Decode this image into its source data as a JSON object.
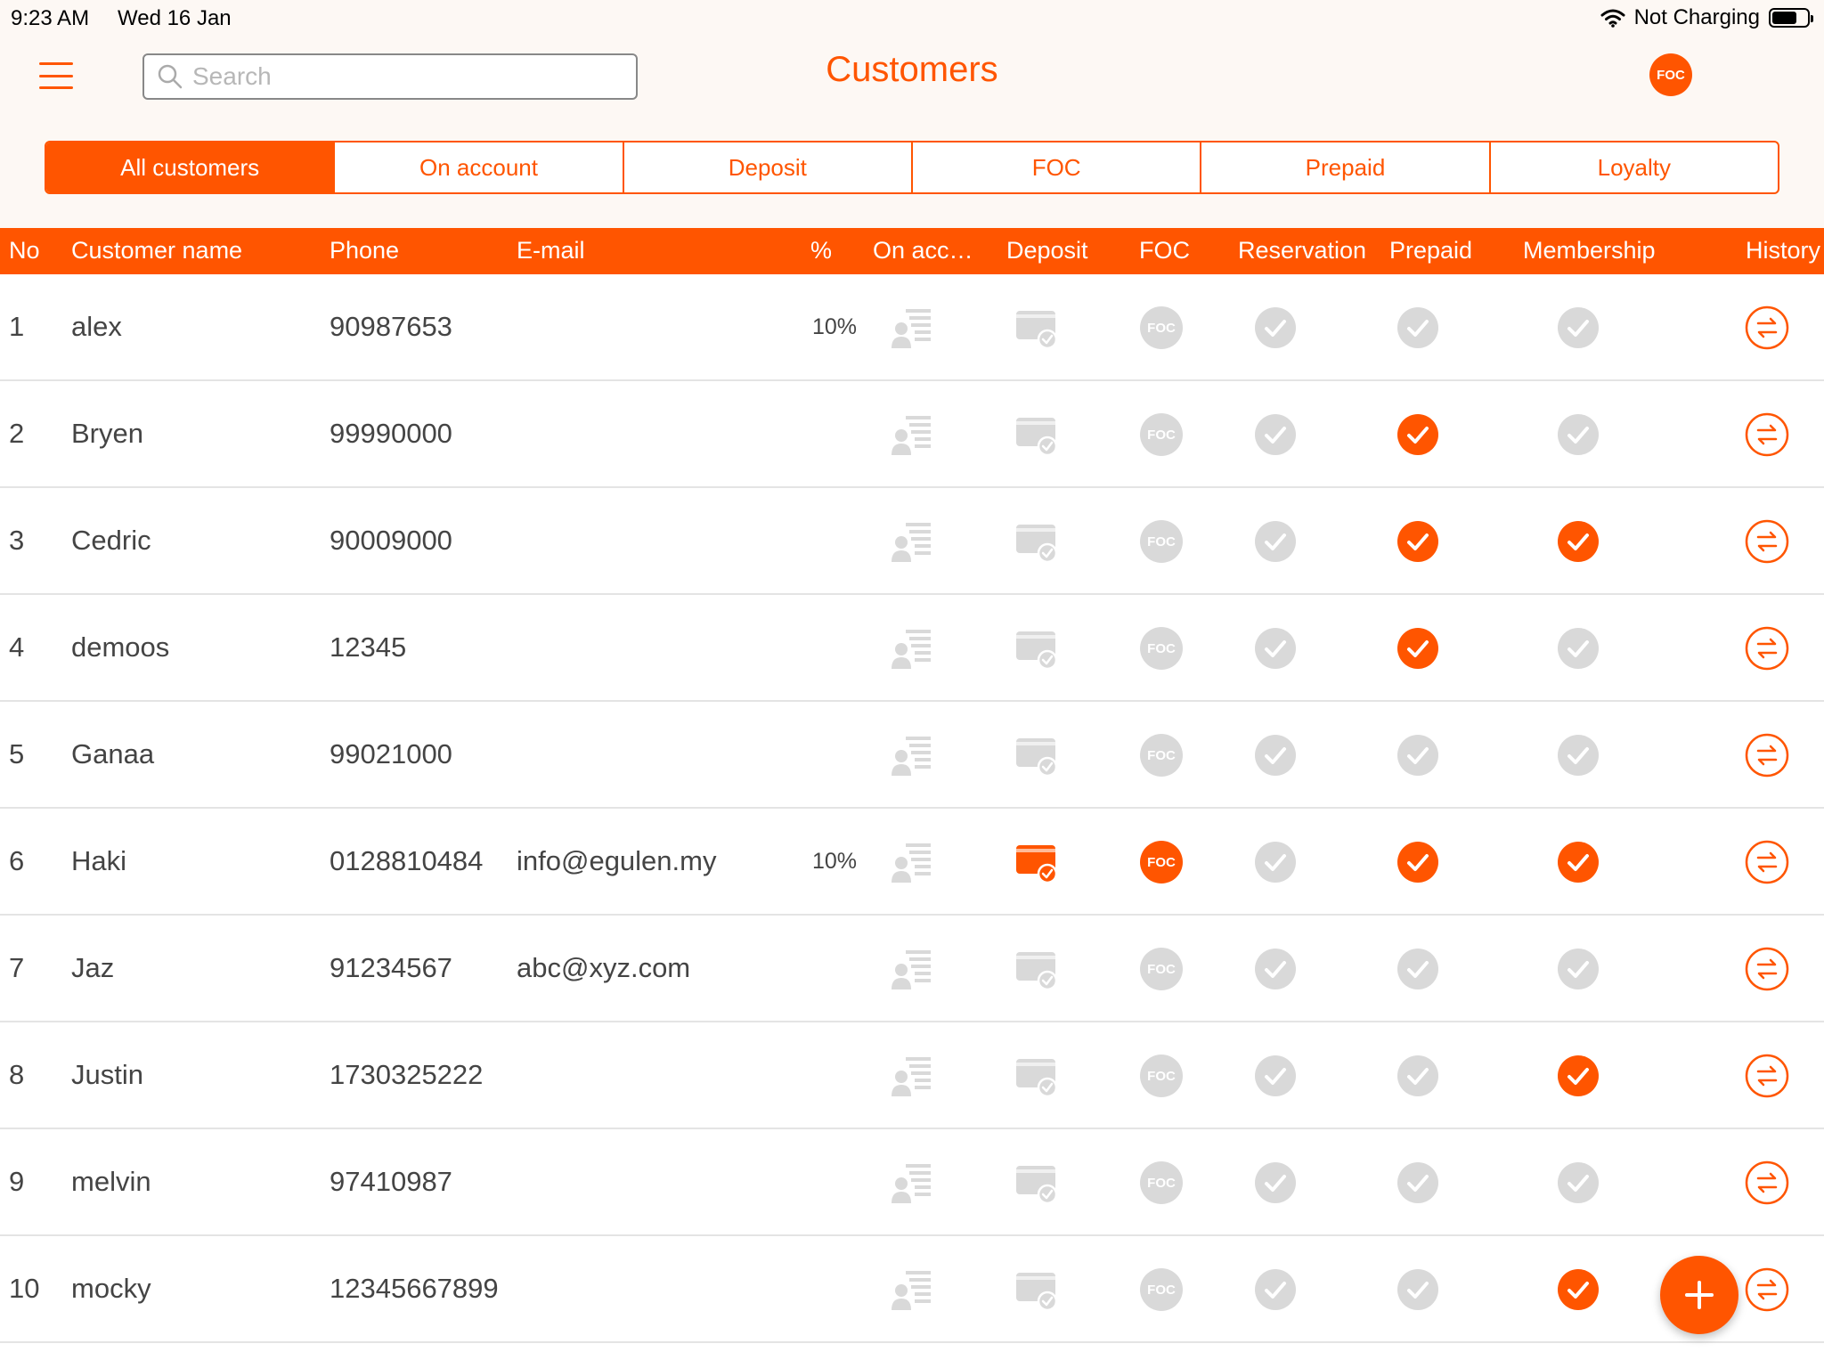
{
  "status_bar": {
    "time": "9:23 AM",
    "date": "Wed 16 Jan",
    "battery_text": "Not Charging"
  },
  "search": {
    "placeholder": "Search"
  },
  "title": "Customers",
  "avatar_badge": "FOC",
  "tabs": [
    {
      "label": "All customers",
      "active": true
    },
    {
      "label": "On account",
      "active": false
    },
    {
      "label": "Deposit",
      "active": false
    },
    {
      "label": "FOC",
      "active": false
    },
    {
      "label": "Prepaid",
      "active": false
    },
    {
      "label": "Loyalty",
      "active": false
    }
  ],
  "columns": {
    "no": "No",
    "name": "Customer name",
    "phone": "Phone",
    "email": "E-mail",
    "pct": "%",
    "on_account": "On acc…",
    "deposit": "Deposit",
    "foc": "FOC",
    "reservation": "Reservation",
    "prepaid": "Prepaid",
    "membership": "Membership",
    "history": "History"
  },
  "icon_label_foc": "FOC",
  "colors": {
    "accent": "#ff5500",
    "inactive": "#d9d9d9",
    "header_bg": "#fdf8f4"
  },
  "icons": {
    "on_account": "account-card-icon",
    "deposit": "deposit-wallet-icon",
    "foc": "foc-badge-icon",
    "check": "check-circle-icon",
    "history": "swap-arrows-icon",
    "add": "plus-icon"
  },
  "customers": [
    {
      "no": "1",
      "name": "alex",
      "phone": "90987653",
      "email": "",
      "pct": "10%",
      "on_account": false,
      "deposit": false,
      "foc": false,
      "reservation": false,
      "prepaid": false,
      "membership": false
    },
    {
      "no": "2",
      "name": "Bryen",
      "phone": "99990000",
      "email": "",
      "pct": "",
      "on_account": false,
      "deposit": false,
      "foc": false,
      "reservation": false,
      "prepaid": true,
      "membership": false
    },
    {
      "no": "3",
      "name": "Cedric",
      "phone": "90009000",
      "email": "",
      "pct": "",
      "on_account": false,
      "deposit": false,
      "foc": false,
      "reservation": false,
      "prepaid": true,
      "membership": true
    },
    {
      "no": "4",
      "name": "demoos",
      "phone": "12345",
      "email": "",
      "pct": "",
      "on_account": false,
      "deposit": false,
      "foc": false,
      "reservation": false,
      "prepaid": true,
      "membership": false
    },
    {
      "no": "5",
      "name": "Ganaa",
      "phone": "99021000",
      "email": "",
      "pct": "",
      "on_account": false,
      "deposit": false,
      "foc": false,
      "reservation": false,
      "prepaid": false,
      "membership": false
    },
    {
      "no": "6",
      "name": "Haki",
      "phone": "0128810484",
      "email": "info@egulen.my",
      "pct": "10%",
      "on_account": false,
      "deposit": true,
      "foc": true,
      "reservation": false,
      "prepaid": true,
      "membership": true
    },
    {
      "no": "7",
      "name": "Jaz",
      "phone": "91234567",
      "email": "abc@xyz.com",
      "pct": "",
      "on_account": false,
      "deposit": false,
      "foc": false,
      "reservation": false,
      "prepaid": false,
      "membership": false
    },
    {
      "no": "8",
      "name": "Justin",
      "phone": "1730325222",
      "email": "",
      "pct": "",
      "on_account": false,
      "deposit": false,
      "foc": false,
      "reservation": false,
      "prepaid": false,
      "membership": true
    },
    {
      "no": "9",
      "name": "melvin",
      "phone": "97410987",
      "email": "",
      "pct": "",
      "on_account": false,
      "deposit": false,
      "foc": false,
      "reservation": false,
      "prepaid": false,
      "membership": false
    },
    {
      "no": "10",
      "name": "mocky",
      "phone": "12345667899",
      "email": "",
      "pct": "",
      "on_account": false,
      "deposit": false,
      "foc": false,
      "reservation": false,
      "prepaid": false,
      "membership": true
    }
  ]
}
